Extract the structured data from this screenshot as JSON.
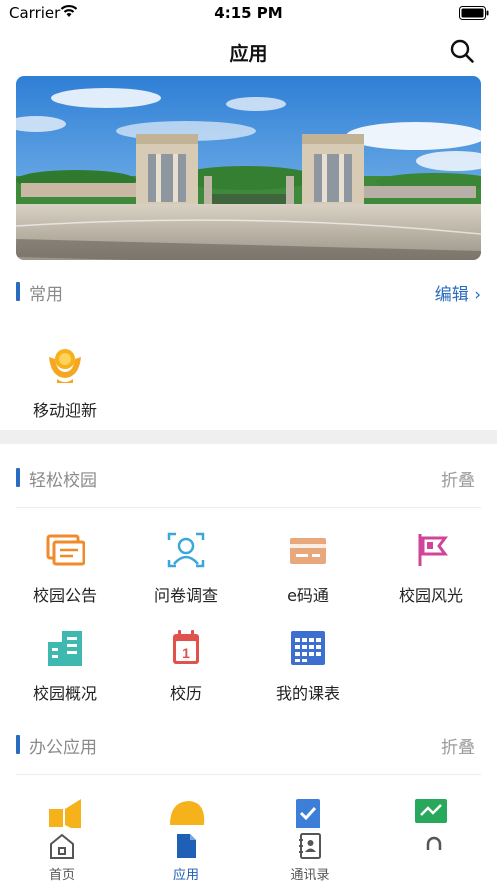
{
  "status_bar": {
    "carrier": "Carrier",
    "time": "4:15 PM"
  },
  "nav": {
    "title": "应用"
  },
  "common_section": {
    "title": "常用",
    "edit_label": "编辑 ›",
    "items": [
      {
        "label": "移动迎新",
        "icon": "welcome-person-icon"
      }
    ]
  },
  "campus_section": {
    "title": "轻松校园",
    "fold_label": "折叠",
    "items": [
      {
        "label": "校园公告",
        "icon": "announcement-icon"
      },
      {
        "label": "问卷调查",
        "icon": "survey-icon"
      },
      {
        "label": "e码通",
        "icon": "ecard-icon"
      },
      {
        "label": "校园风光",
        "icon": "flag-icon"
      },
      {
        "label": "校园概况",
        "icon": "building-icon"
      },
      {
        "label": "校历",
        "icon": "calendar-icon"
      },
      {
        "label": "我的课表",
        "icon": "timetable-icon"
      }
    ]
  },
  "office_section": {
    "title": "办公应用",
    "fold_label": "折叠"
  },
  "tab_bar": {
    "tabs": [
      {
        "label": "首页",
        "icon": "home-icon"
      },
      {
        "label": "应用",
        "icon": "apps-icon",
        "active": true
      },
      {
        "label": "通讯录",
        "icon": "contacts-icon"
      },
      {
        "label": "",
        "icon": "profile-icon"
      }
    ]
  },
  "colors": {
    "accent": "#2a6cc0",
    "orange": "#f5a623",
    "teal": "#3fb8b0",
    "pink": "#d0459a",
    "red": "#e0524c",
    "blue": "#3d6fd0"
  }
}
